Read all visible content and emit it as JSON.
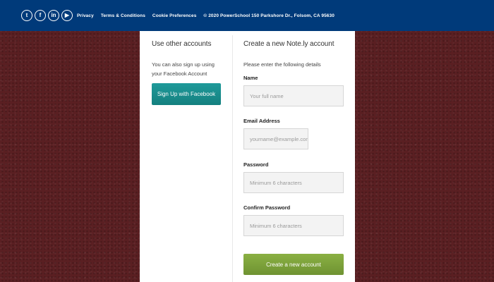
{
  "footer": {
    "social": [
      {
        "icon": "twitter-icon",
        "glyph": "t"
      },
      {
        "icon": "facebook-icon",
        "glyph": "f"
      },
      {
        "icon": "linkedin-icon",
        "glyph": "in"
      },
      {
        "icon": "youtube-icon",
        "glyph": "▶"
      }
    ],
    "links": [
      "Privacy",
      "Terms & Conditions",
      "Cookie Preferences"
    ],
    "copyright": "© 2020 PowerSchool 150 Parkshore Dr., Folsom, CA 95630"
  },
  "left": {
    "heading": "Use other accounts",
    "description": "You can also sign up using your Facebook Account",
    "facebook_button": "Sign Up with Facebook"
  },
  "right": {
    "heading": "Create a new Note.ly account",
    "instructions": "Please enter the following details",
    "name_label": "Name",
    "name_placeholder": "Your full name",
    "email_label": "Email Address",
    "email_placeholder": "yourname@example.com",
    "password_label": "Password",
    "password_placeholder": "Minimum 6 characters",
    "confirm_label": "Confirm Password",
    "confirm_placeholder": "Minimum 6 characters",
    "create_button": "Create a new account"
  },
  "colors": {
    "header_bg": "#003a7a",
    "page_bg": "#5a1f22",
    "facebook_button": "#1a8e8e",
    "create_button": "#7ea13c"
  }
}
